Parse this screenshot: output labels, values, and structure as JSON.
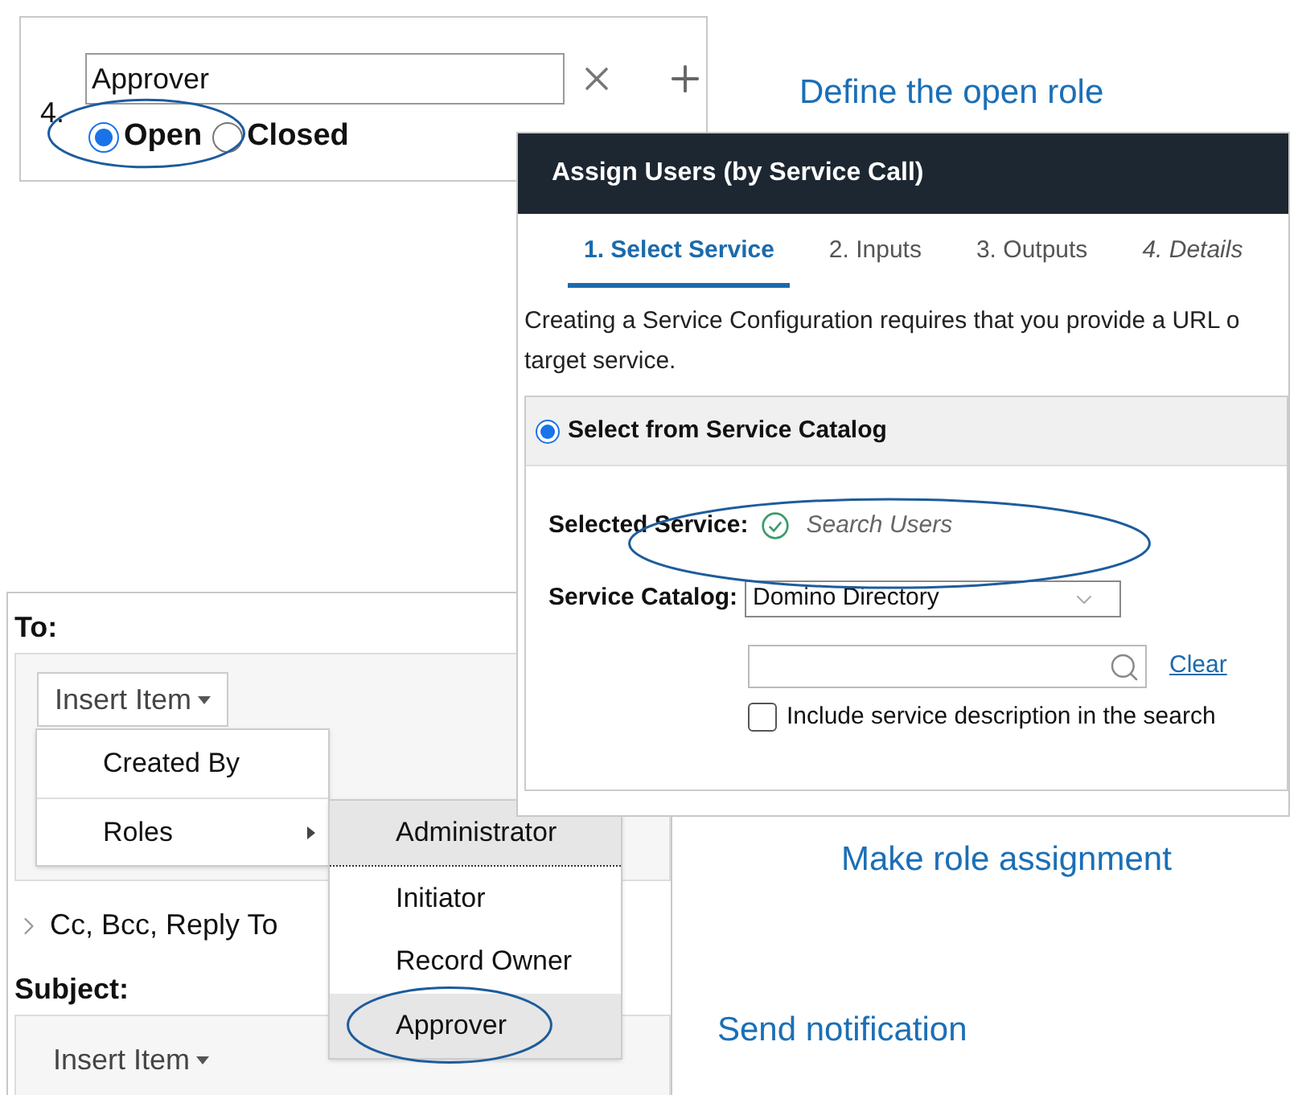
{
  "role_editor": {
    "number": "4.",
    "role_name": "Approver",
    "access": [
      {
        "label": "Open",
        "selected": true
      },
      {
        "label": "Closed",
        "selected": false
      }
    ]
  },
  "assign_dialog": {
    "title": "Assign Users (by Service Call)",
    "steps": [
      {
        "label": "1. Select Service",
        "selected": true,
        "disabled": false
      },
      {
        "label": "2. Inputs",
        "selected": false,
        "disabled": false
      },
      {
        "label": "3. Outputs",
        "selected": false,
        "disabled": false
      },
      {
        "label": "4. Details",
        "selected": false,
        "disabled": true
      }
    ],
    "description": [
      "Creating a Service Configuration requires that you provide a URL o",
      "target service."
    ],
    "source": {
      "label": "Select from Service Catalog",
      "selected": true
    },
    "selected_service": {
      "label": "Selected Service:",
      "value": "Search Users"
    },
    "service_catalog": {
      "label": "Service Catalog:",
      "value": "Domino Directory"
    },
    "search": {
      "clear_link": "Clear"
    },
    "include_description": {
      "label": "Include service description in the search",
      "checked": false
    }
  },
  "notification": {
    "to_label": "To:",
    "insert_button": "Insert Item",
    "menu": [
      {
        "label": "Created By",
        "has_submenu": false
      },
      {
        "label": "Roles",
        "has_submenu": true
      }
    ],
    "submenu": [
      {
        "label": "Administrator",
        "selected": true
      },
      {
        "label": "Initiator",
        "selected": false
      },
      {
        "label": "Record Owner",
        "selected": false
      },
      {
        "label": "Approver",
        "selected": true
      }
    ],
    "cc_toggle": {
      "label": "Cc, Bcc, Reply To",
      "expanded": false
    },
    "subject_label": "Subject:",
    "subject_insert_button": "Insert Item"
  },
  "captions": [
    "Define the open role",
    "Make role assignment",
    "Send notification"
  ]
}
